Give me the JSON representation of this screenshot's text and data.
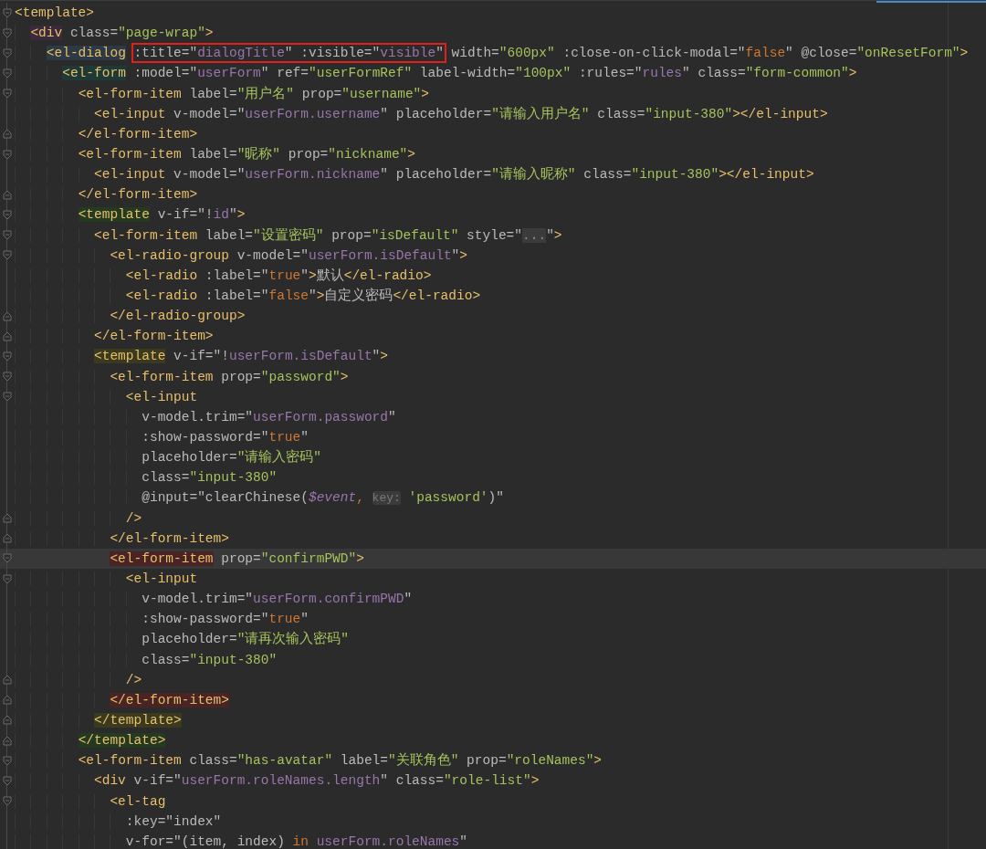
{
  "editor": {
    "lines": [
      {
        "fold_open": true,
        "fold_close": false,
        "current": false,
        "tokens": [
          {
            "kind": "tag",
            "text": "<template>"
          }
        ]
      },
      {
        "fold_open": true,
        "fold_close": false,
        "current": false,
        "tokens": [
          {
            "kind": "tag",
            "text": "  <div",
            "color": "#3b2a3c"
          },
          {
            "kind": "attr",
            "text": " class="
          },
          {
            "kind": "str",
            "text": "\"page-wrap\""
          },
          {
            "kind": "tag",
            "text": ">"
          }
        ]
      },
      {
        "fold_open": true,
        "fold_close": false,
        "current": false,
        "tokens": [
          {
            "kind": "tag",
            "text": "    <el-dialog",
            "color": "#2d3944"
          },
          {
            "kind": "group",
            "boxed": true,
            "tokens": [
              {
                "kind": "attr",
                "text": ":title=\""
              },
              {
                "kind": "var",
                "text": "dialogTitle"
              },
              {
                "kind": "attr",
                "text": "\" :visible=\""
              },
              {
                "kind": "var",
                "text": "visible"
              },
              {
                "kind": "attr",
                "text": "\""
              }
            ]
          },
          {
            "kind": "attr",
            "text": "width="
          },
          {
            "kind": "str",
            "text": "\"600px\""
          },
          {
            "kind": "attr",
            "text": " :close-on-click-modal=\""
          },
          {
            "kind": "kw",
            "text": "false"
          },
          {
            "kind": "attr",
            "text": "\" @close="
          },
          {
            "kind": "str",
            "text": "\"onResetForm\""
          },
          {
            "kind": "tag",
            "text": ">"
          }
        ]
      },
      {
        "fold_open": true,
        "fold_close": false,
        "current": false,
        "tokens": [
          {
            "kind": "tag",
            "text": "      <el-form",
            "color": "#1f3a36"
          },
          {
            "kind": "attr",
            "text": " :model=\""
          },
          {
            "kind": "var",
            "text": "userForm"
          },
          {
            "kind": "attr",
            "text": "\" ref="
          },
          {
            "kind": "str",
            "text": "\"userFormRef\""
          },
          {
            "kind": "attr",
            "text": " label-width="
          },
          {
            "kind": "str",
            "text": "\"100px\""
          },
          {
            "kind": "attr",
            "text": " :rules=\""
          },
          {
            "kind": "var",
            "text": "rules"
          },
          {
            "kind": "attr",
            "text": "\" class="
          },
          {
            "kind": "str",
            "text": "\"form-common\""
          },
          {
            "kind": "tag",
            "text": ">"
          }
        ]
      },
      {
        "fold_open": true,
        "fold_close": false,
        "current": false,
        "tokens": [
          {
            "kind": "tag",
            "text": "        <el-form-item"
          },
          {
            "kind": "attr",
            "text": " label="
          },
          {
            "kind": "str",
            "text": "\"用户名\""
          },
          {
            "kind": "attr",
            "text": " prop="
          },
          {
            "kind": "str",
            "text": "\"username\""
          },
          {
            "kind": "tag",
            "text": ">"
          }
        ]
      },
      {
        "fold_open": false,
        "fold_close": false,
        "current": false,
        "tokens": [
          {
            "kind": "tag",
            "text": "          <el-input"
          },
          {
            "kind": "attr",
            "text": " v-model=\""
          },
          {
            "kind": "var",
            "text": "userForm.username"
          },
          {
            "kind": "attr",
            "text": "\" placeholder="
          },
          {
            "kind": "str",
            "text": "\"请输入用户名\""
          },
          {
            "kind": "attr",
            "text": " class="
          },
          {
            "kind": "str",
            "text": "\"input-380\""
          },
          {
            "kind": "tag",
            "text": "></el-input>"
          }
        ]
      },
      {
        "fold_open": false,
        "fold_close": true,
        "current": false,
        "tokens": [
          {
            "kind": "tag",
            "text": "        </el-form-item>"
          }
        ]
      },
      {
        "fold_open": true,
        "fold_close": false,
        "current": false,
        "tokens": [
          {
            "kind": "tag",
            "text": "        <el-form-item"
          },
          {
            "kind": "attr",
            "text": " label="
          },
          {
            "kind": "str",
            "text": "\"昵称\""
          },
          {
            "kind": "attr",
            "text": " prop="
          },
          {
            "kind": "str",
            "text": "\"nickname\""
          },
          {
            "kind": "tag",
            "text": ">"
          }
        ]
      },
      {
        "fold_open": false,
        "fold_close": false,
        "current": false,
        "tokens": [
          {
            "kind": "tag",
            "text": "          <el-input"
          },
          {
            "kind": "attr",
            "text": " v-model=\""
          },
          {
            "kind": "var",
            "text": "userForm.nickname"
          },
          {
            "kind": "attr",
            "text": "\" placeholder="
          },
          {
            "kind": "str",
            "text": "\"请输入昵称\""
          },
          {
            "kind": "attr",
            "text": " class="
          },
          {
            "kind": "str",
            "text": "\"input-380\""
          },
          {
            "kind": "tag",
            "text": "></el-input>"
          }
        ]
      },
      {
        "fold_open": false,
        "fold_close": true,
        "current": false,
        "tokens": [
          {
            "kind": "tag",
            "text": "        </el-form-item>"
          }
        ]
      },
      {
        "fold_open": true,
        "fold_close": false,
        "current": false,
        "tokens": [
          {
            "kind": "tag",
            "text": "        <template",
            "color": "#243b22"
          },
          {
            "kind": "attr",
            "text": " v-if=\"!"
          },
          {
            "kind": "var",
            "text": "id"
          },
          {
            "kind": "attr",
            "text": "\""
          },
          {
            "kind": "tag",
            "text": ">"
          }
        ]
      },
      {
        "fold_open": true,
        "fold_close": false,
        "current": false,
        "tokens": [
          {
            "kind": "tag",
            "text": "          <el-form-item"
          },
          {
            "kind": "attr",
            "text": " label="
          },
          {
            "kind": "str",
            "text": "\"设置密码\""
          },
          {
            "kind": "attr",
            "text": " prop="
          },
          {
            "kind": "str",
            "text": "\"isDefault\""
          },
          {
            "kind": "attr",
            "text": " style=\""
          },
          {
            "kind": "fold",
            "text": "..."
          },
          {
            "kind": "attr",
            "text": "\""
          },
          {
            "kind": "tag",
            "text": ">"
          }
        ]
      },
      {
        "fold_open": true,
        "fold_close": false,
        "current": false,
        "tokens": [
          {
            "kind": "tag",
            "text": "            <el-radio-group"
          },
          {
            "kind": "attr",
            "text": " v-model=\""
          },
          {
            "kind": "var",
            "text": "userForm.isDefault"
          },
          {
            "kind": "attr",
            "text": "\""
          },
          {
            "kind": "tag",
            "text": ">"
          }
        ]
      },
      {
        "fold_open": false,
        "fold_close": false,
        "current": false,
        "tokens": [
          {
            "kind": "tag",
            "text": "              <el-radio"
          },
          {
            "kind": "attr",
            "text": " :label=\""
          },
          {
            "kind": "kw",
            "text": "true"
          },
          {
            "kind": "attr",
            "text": "\""
          },
          {
            "kind": "tag",
            "text": ">"
          },
          {
            "kind": "attr",
            "text": "默认"
          },
          {
            "kind": "tag",
            "text": "</el-radio>"
          }
        ]
      },
      {
        "fold_open": false,
        "fold_close": false,
        "current": false,
        "tokens": [
          {
            "kind": "tag",
            "text": "              <el-radio"
          },
          {
            "kind": "attr",
            "text": " :label=\""
          },
          {
            "kind": "kw",
            "text": "false"
          },
          {
            "kind": "attr",
            "text": "\""
          },
          {
            "kind": "tag",
            "text": ">"
          },
          {
            "kind": "attr",
            "text": "自定义密码"
          },
          {
            "kind": "tag",
            "text": "</el-radio>"
          }
        ]
      },
      {
        "fold_open": false,
        "fold_close": true,
        "current": false,
        "tokens": [
          {
            "kind": "tag",
            "text": "            </el-radio-group>"
          }
        ]
      },
      {
        "fold_open": false,
        "fold_close": true,
        "current": false,
        "tokens": [
          {
            "kind": "tag",
            "text": "          </el-form-item>"
          }
        ]
      },
      {
        "fold_open": true,
        "fold_close": false,
        "current": false,
        "tokens": [
          {
            "kind": "tag",
            "text": "          <template",
            "color": "#3b3a1f"
          },
          {
            "kind": "attr",
            "text": " v-if=\"!"
          },
          {
            "kind": "var",
            "text": "userForm.isDefault"
          },
          {
            "kind": "attr",
            "text": "\""
          },
          {
            "kind": "tag",
            "text": ">"
          }
        ]
      },
      {
        "fold_open": true,
        "fold_close": false,
        "current": false,
        "tokens": [
          {
            "kind": "tag",
            "text": "            <el-form-item"
          },
          {
            "kind": "attr",
            "text": " prop="
          },
          {
            "kind": "str",
            "text": "\"password\""
          },
          {
            "kind": "tag",
            "text": ">"
          }
        ]
      },
      {
        "fold_open": true,
        "fold_close": false,
        "current": false,
        "tokens": [
          {
            "kind": "tag",
            "text": "              <el-input"
          }
        ]
      },
      {
        "fold_open": false,
        "fold_close": false,
        "current": false,
        "tokens": [
          {
            "kind": "attr",
            "text": "                v-model.trim=\""
          },
          {
            "kind": "var",
            "text": "userForm.password"
          },
          {
            "kind": "attr",
            "text": "\""
          }
        ]
      },
      {
        "fold_open": false,
        "fold_close": false,
        "current": false,
        "tokens": [
          {
            "kind": "attr",
            "text": "                :show-password=\""
          },
          {
            "kind": "kw",
            "text": "true"
          },
          {
            "kind": "attr",
            "text": "\""
          }
        ]
      },
      {
        "fold_open": false,
        "fold_close": false,
        "current": false,
        "tokens": [
          {
            "kind": "attr",
            "text": "                placeholder="
          },
          {
            "kind": "str",
            "text": "\"请输入密码\""
          }
        ]
      },
      {
        "fold_open": false,
        "fold_close": false,
        "current": false,
        "tokens": [
          {
            "kind": "attr",
            "text": "                class="
          },
          {
            "kind": "str",
            "text": "\"input-380\""
          }
        ]
      },
      {
        "fold_open": false,
        "fold_close": false,
        "current": false,
        "tokens": [
          {
            "kind": "attr",
            "text": "                @input=\"clearChinese("
          },
          {
            "kind": "italic",
            "text": "$event"
          },
          {
            "kind": "kw",
            "text": ", "
          },
          {
            "kind": "hint",
            "text": "key:"
          },
          {
            "kind": "str",
            "text": " 'password'"
          },
          {
            "kind": "attr",
            "text": ")\""
          }
        ]
      },
      {
        "fold_open": false,
        "fold_close": true,
        "current": false,
        "tokens": [
          {
            "kind": "tag",
            "text": "              />"
          }
        ]
      },
      {
        "fold_open": false,
        "fold_close": true,
        "current": false,
        "tokens": [
          {
            "kind": "tag",
            "text": "            </el-form-item>"
          }
        ]
      },
      {
        "fold_open": true,
        "fold_close": false,
        "current": true,
        "tokens": [
          {
            "kind": "tag",
            "text": "            <el-form-item",
            "color": "#4a2424"
          },
          {
            "kind": "attr",
            "text": " prop="
          },
          {
            "kind": "str",
            "text": "\"confirmPWD\""
          },
          {
            "kind": "tag",
            "text": ">"
          }
        ]
      },
      {
        "fold_open": true,
        "fold_close": false,
        "current": false,
        "tokens": [
          {
            "kind": "tag",
            "text": "              <el-input"
          }
        ]
      },
      {
        "fold_open": false,
        "fold_close": false,
        "current": false,
        "tokens": [
          {
            "kind": "attr",
            "text": "                v-model.trim=\""
          },
          {
            "kind": "var",
            "text": "userForm.confirmPWD"
          },
          {
            "kind": "attr",
            "text": "\""
          }
        ]
      },
      {
        "fold_open": false,
        "fold_close": false,
        "current": false,
        "tokens": [
          {
            "kind": "attr",
            "text": "                :show-password=\""
          },
          {
            "kind": "kw",
            "text": "true"
          },
          {
            "kind": "attr",
            "text": "\""
          }
        ]
      },
      {
        "fold_open": false,
        "fold_close": false,
        "current": false,
        "tokens": [
          {
            "kind": "attr",
            "text": "                placeholder="
          },
          {
            "kind": "str",
            "text": "\"请再次输入密码\""
          }
        ]
      },
      {
        "fold_open": false,
        "fold_close": false,
        "current": false,
        "tokens": [
          {
            "kind": "attr",
            "text": "                class="
          },
          {
            "kind": "str",
            "text": "\"input-380\""
          }
        ]
      },
      {
        "fold_open": false,
        "fold_close": true,
        "current": false,
        "tokens": [
          {
            "kind": "tag",
            "text": "              />"
          }
        ]
      },
      {
        "fold_open": false,
        "fold_close": true,
        "current": false,
        "tokens": [
          {
            "kind": "tag",
            "text": "            </el-form-item>",
            "color": "#4a2424"
          }
        ]
      },
      {
        "fold_open": false,
        "fold_close": true,
        "current": false,
        "tokens": [
          {
            "kind": "tag",
            "text": "          </template>",
            "color": "#3b3a1f"
          }
        ]
      },
      {
        "fold_open": false,
        "fold_close": true,
        "current": false,
        "tokens": [
          {
            "kind": "tag",
            "text": "        </template>",
            "color": "#243b22"
          }
        ]
      },
      {
        "fold_open": true,
        "fold_close": false,
        "current": false,
        "tokens": [
          {
            "kind": "tag",
            "text": "        <el-form-item"
          },
          {
            "kind": "attr",
            "text": " class="
          },
          {
            "kind": "str",
            "text": "\"has-avatar\""
          },
          {
            "kind": "attr",
            "text": " label="
          },
          {
            "kind": "str",
            "text": "\"关联角色\""
          },
          {
            "kind": "attr",
            "text": " prop="
          },
          {
            "kind": "str",
            "text": "\"roleNames\""
          },
          {
            "kind": "tag",
            "text": ">"
          }
        ]
      },
      {
        "fold_open": true,
        "fold_close": false,
        "current": false,
        "tokens": [
          {
            "kind": "tag",
            "text": "          <div"
          },
          {
            "kind": "attr",
            "text": " v-if=\""
          },
          {
            "kind": "var",
            "text": "userForm.roleNames.length"
          },
          {
            "kind": "attr",
            "text": "\" class="
          },
          {
            "kind": "str",
            "text": "\"role-list\""
          },
          {
            "kind": "tag",
            "text": ">"
          }
        ]
      },
      {
        "fold_open": true,
        "fold_close": false,
        "current": false,
        "tokens": [
          {
            "kind": "tag",
            "text": "            <el-tag"
          }
        ]
      },
      {
        "fold_open": false,
        "fold_close": false,
        "current": false,
        "tokens": [
          {
            "kind": "attr",
            "text": "              :key=\"index\""
          }
        ]
      },
      {
        "fold_open": false,
        "fold_close": false,
        "current": false,
        "tokens": [
          {
            "kind": "attr",
            "text": "              v-for=\"(item, index) "
          },
          {
            "kind": "kw",
            "text": "in"
          },
          {
            "kind": "var",
            "text": " userForm.roleNames"
          },
          {
            "kind": "attr",
            "text": "\""
          }
        ]
      }
    ]
  }
}
